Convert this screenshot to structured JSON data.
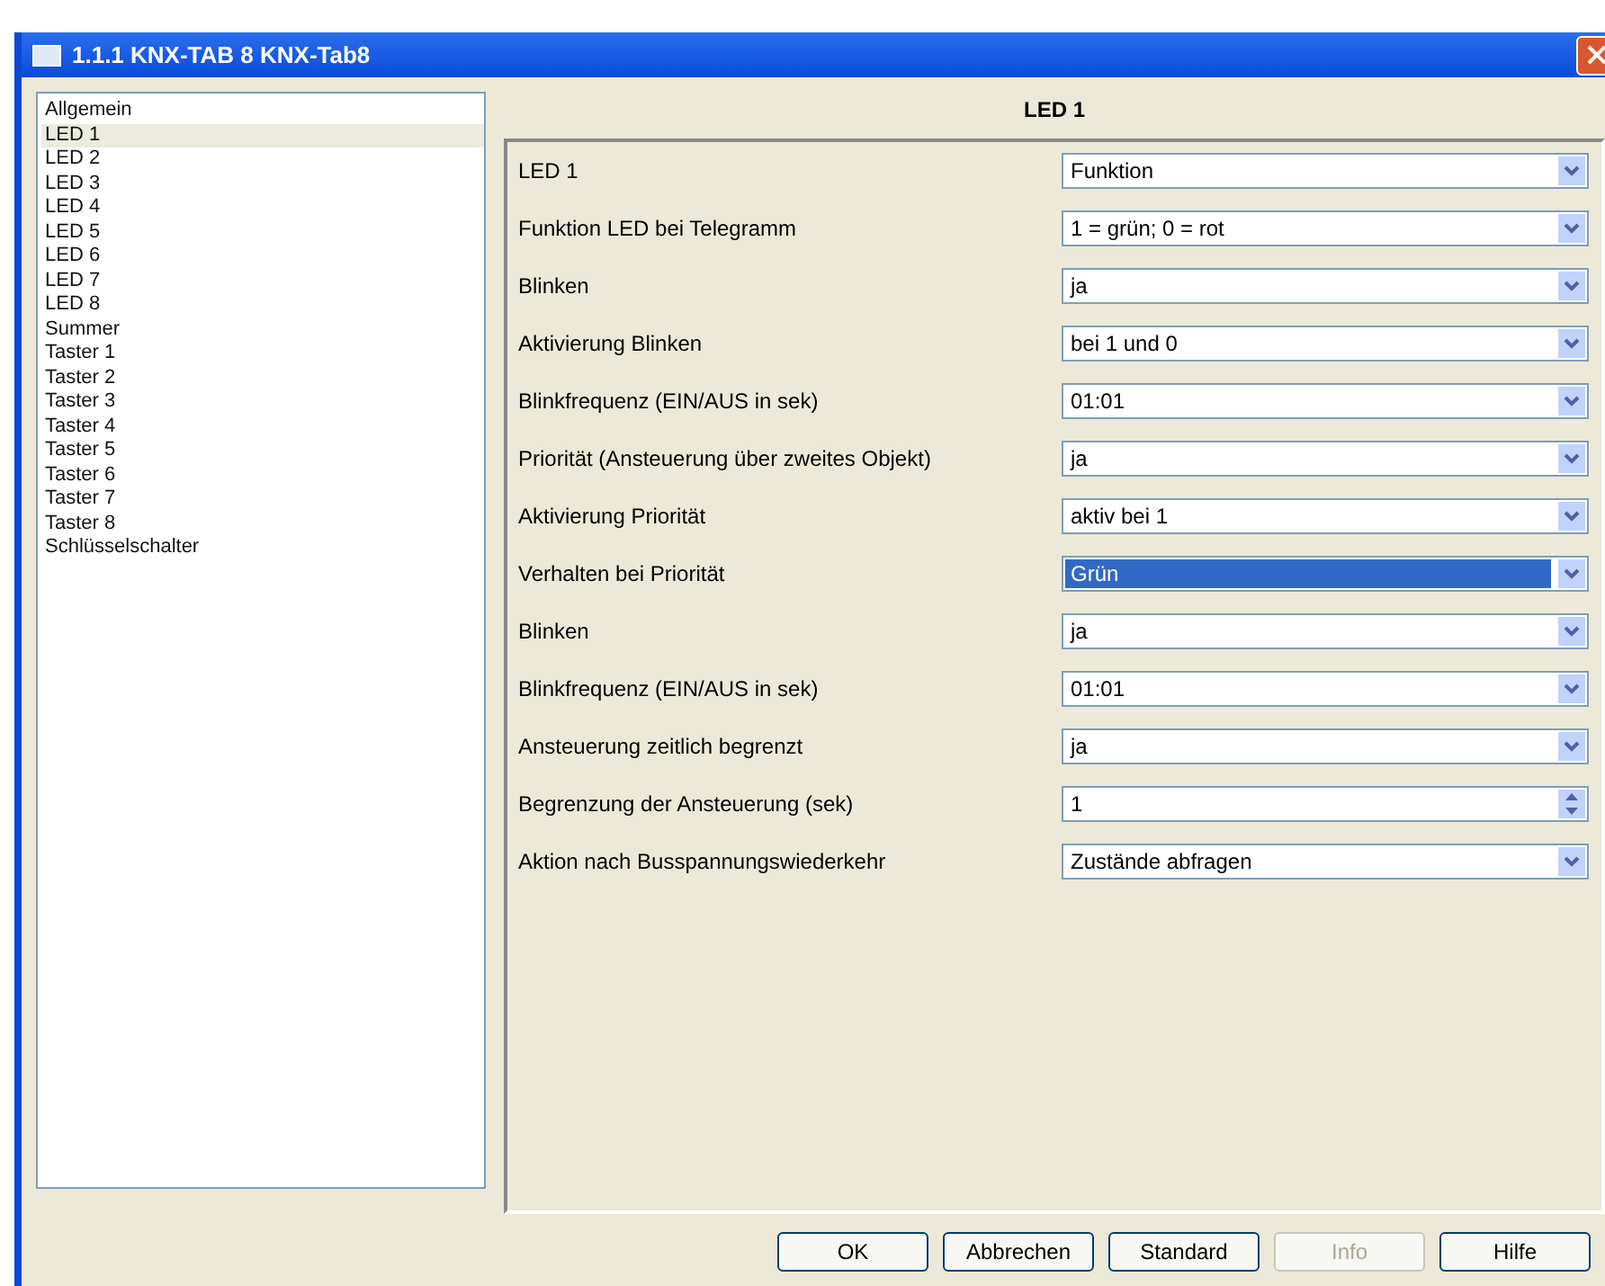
{
  "window": {
    "title": "1.1.1 KNX-TAB 8 KNX-Tab8"
  },
  "sidebar": {
    "items": [
      {
        "label": "Allgemein",
        "selected": false
      },
      {
        "label": "LED 1",
        "selected": true
      },
      {
        "label": "LED 2",
        "selected": false
      },
      {
        "label": "LED 3",
        "selected": false
      },
      {
        "label": "LED 4",
        "selected": false
      },
      {
        "label": "LED 5",
        "selected": false
      },
      {
        "label": "LED 6",
        "selected": false
      },
      {
        "label": "LED 7",
        "selected": false
      },
      {
        "label": "LED 8",
        "selected": false
      },
      {
        "label": "Summer",
        "selected": false
      },
      {
        "label": "Taster 1",
        "selected": false
      },
      {
        "label": "Taster 2",
        "selected": false
      },
      {
        "label": "Taster 3",
        "selected": false
      },
      {
        "label": "Taster 4",
        "selected": false
      },
      {
        "label": "Taster 5",
        "selected": false
      },
      {
        "label": "Taster 6",
        "selected": false
      },
      {
        "label": "Taster 7",
        "selected": false
      },
      {
        "label": "Taster 8",
        "selected": false
      },
      {
        "label": "Schlüsselschalter",
        "selected": false
      }
    ]
  },
  "panel": {
    "title": "LED 1",
    "rows": [
      {
        "label": "LED 1",
        "kind": "select",
        "value": "Funktion",
        "focused": false
      },
      {
        "label": "Funktion LED bei Telegramm",
        "kind": "select",
        "value": "1 = grün; 0 = rot",
        "focused": false
      },
      {
        "label": "Blinken",
        "kind": "select",
        "value": "ja",
        "focused": false
      },
      {
        "label": "Aktivierung Blinken",
        "kind": "select",
        "value": "bei 1 und 0",
        "focused": false
      },
      {
        "label": "Blinkfrequenz (EIN/AUS in sek)",
        "kind": "select",
        "value": "01:01",
        "focused": false
      },
      {
        "label": "Priorität (Ansteuerung über zweites Objekt)",
        "kind": "select",
        "value": "ja",
        "focused": false
      },
      {
        "label": "Aktivierung Priorität",
        "kind": "select",
        "value": "aktiv bei 1",
        "focused": false
      },
      {
        "label": "Verhalten bei Priorität",
        "kind": "select",
        "value": "Grün",
        "focused": true
      },
      {
        "label": "Blinken",
        "kind": "select",
        "value": "ja",
        "focused": false
      },
      {
        "label": "Blinkfrequenz (EIN/AUS in sek)",
        "kind": "select",
        "value": "01:01",
        "focused": false
      },
      {
        "label": "Ansteuerung zeitlich begrenzt",
        "kind": "select",
        "value": "ja",
        "focused": false
      },
      {
        "label": "Begrenzung der Ansteuerung (sek)",
        "kind": "spin",
        "value": "1",
        "focused": false
      },
      {
        "label": "Aktion nach Busspannungswiederkehr",
        "kind": "select",
        "value": "Zustände abfragen",
        "focused": false
      }
    ]
  },
  "buttons": [
    {
      "label": "OK",
      "disabled": false
    },
    {
      "label": "Abbrechen",
      "disabled": false
    },
    {
      "label": "Standard",
      "disabled": false
    },
    {
      "label": "Info",
      "disabled": true
    },
    {
      "label": "Hilfe",
      "disabled": false
    }
  ]
}
